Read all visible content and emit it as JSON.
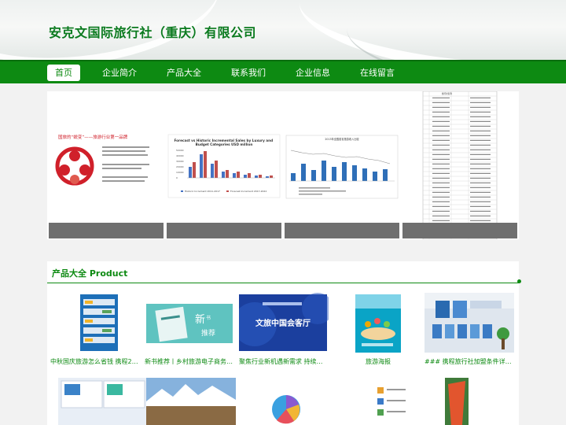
{
  "site": {
    "title": "安克文国际旅行社（重庆）有限公司"
  },
  "nav": {
    "items": [
      {
        "label": "首页",
        "active": true
      },
      {
        "label": "企业简介"
      },
      {
        "label": "产品大全"
      },
      {
        "label": "联系我们"
      },
      {
        "label": "企业信息"
      },
      {
        "label": "在线留言"
      }
    ]
  },
  "carousel": {
    "slides": [
      {
        "heading": "国旅的“蜕变”——旅游行业第一品牌"
      },
      {
        "heading": "Forecast vs Historic Incremental Sales by Luxury and Budget Categories USD million",
        "chart_values": [
          50000,
          40000,
          30000,
          20000,
          10000,
          0
        ],
        "legend": [
          "Historic Increment 2011-2017",
          "Forecast Increment 2017-2022"
        ]
      },
      {
        "heading": "2013年全国各省旅游收入比较"
      },
      {
        "heading": "旅行社名称"
      }
    ]
  },
  "products": {
    "heading": "产品大全 Product",
    "row1": [
      {
        "label": "中秋国庆旅游怎么省钱 携程20周..."
      },
      {
        "label": "新书推荐丨乡村旅游电子商务发展..."
      },
      {
        "label": "聚焦行业新机遇新需求 持续做强..."
      },
      {
        "label": "旅游海报"
      },
      {
        "label": "### 携程旅行社加盟条件详解 携..."
      }
    ]
  },
  "colors": {
    "brand_green": "#0d8a12",
    "title_green": "#0a7a1e"
  }
}
